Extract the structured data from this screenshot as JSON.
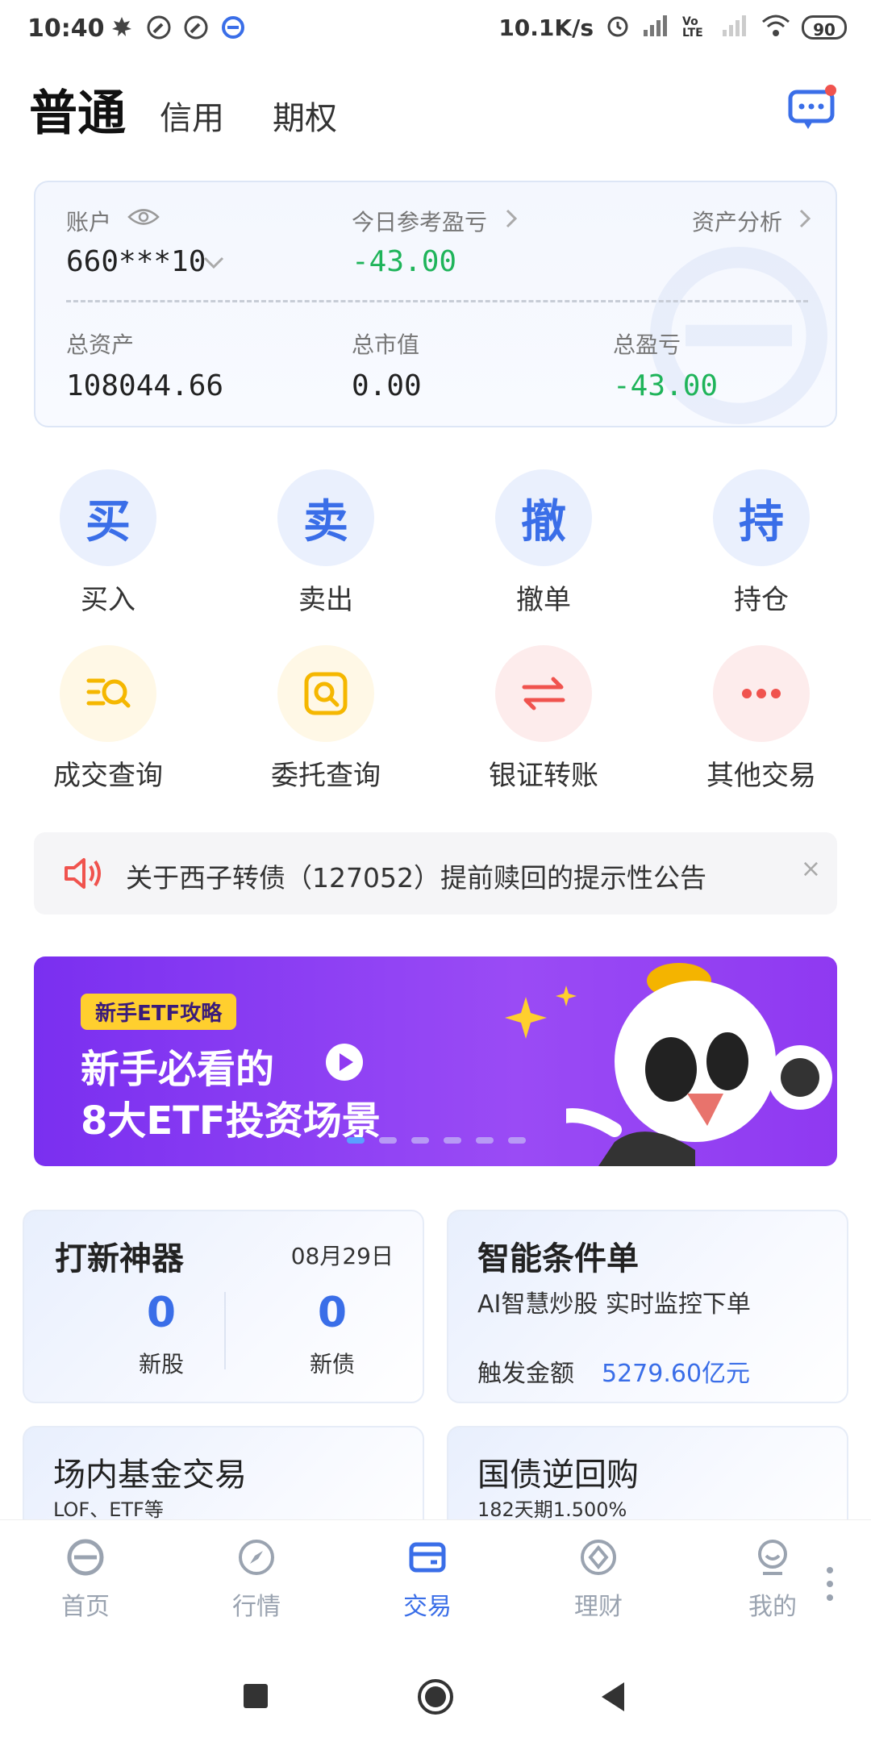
{
  "status_bar": {
    "time": "10:40",
    "speed": "10.1K/s",
    "battery": "90",
    "network": "Vo LTE"
  },
  "header": {
    "tabs": [
      "普通",
      "信用",
      "期权"
    ],
    "active_tab": "普通"
  },
  "account": {
    "account_label": "账户",
    "account_number": "660***10",
    "today_pnl_label": "今日参考盈亏",
    "today_pnl_value": "-43.00",
    "analysis_link": "资产分析",
    "total_assets_label": "总资产",
    "total_assets_value": "108044.66",
    "market_value_label": "总市值",
    "market_value_value": "0.00",
    "total_pnl_label": "总盈亏",
    "total_pnl_value": "-43.00"
  },
  "quick_actions": [
    {
      "glyph": "买",
      "label": "买入"
    },
    {
      "glyph": "卖",
      "label": "卖出"
    },
    {
      "glyph": "撤",
      "label": "撤单"
    },
    {
      "glyph": "持",
      "label": "持仓"
    },
    {
      "icon": "search-list-icon",
      "label": "成交查询"
    },
    {
      "icon": "search-doc-icon",
      "label": "委托查询"
    },
    {
      "icon": "transfer-icon",
      "label": "银证转账"
    },
    {
      "icon": "more-icon",
      "label": "其他交易"
    }
  ],
  "notice": {
    "text": "关于西子转债（127052）提前赎回的提示性公告",
    "close": "×"
  },
  "banner": {
    "tag": "新手ETF攻略",
    "line1": "新手必看的",
    "line2": "8大ETF投资场景"
  },
  "cards": {
    "ipo": {
      "title": "打新神器",
      "date": "08月29日",
      "new_stock_count": "0",
      "new_stock_label": "新股",
      "new_bond_count": "0",
      "new_bond_label": "新债"
    },
    "smart_order": {
      "title": "智能条件单",
      "subtitle": "AI智慧炒股 实时监控下单",
      "trigger_label": "触发金额",
      "trigger_value": "5279.60亿元"
    },
    "fund": {
      "title": "场内基金交易",
      "subtitle": "LOF、ETF等"
    },
    "repo": {
      "title": "国债逆回购",
      "subtitle": "182天期1.500%"
    }
  },
  "bottom_nav": [
    {
      "label": "首页"
    },
    {
      "label": "行情"
    },
    {
      "label": "交易"
    },
    {
      "label": "理财"
    },
    {
      "label": "我的"
    }
  ],
  "colors": {
    "accent": "#3a6ee8",
    "loss_green": "#1fb45a",
    "banner_purple": "#8f39f1",
    "notice_red": "#f0534e"
  }
}
